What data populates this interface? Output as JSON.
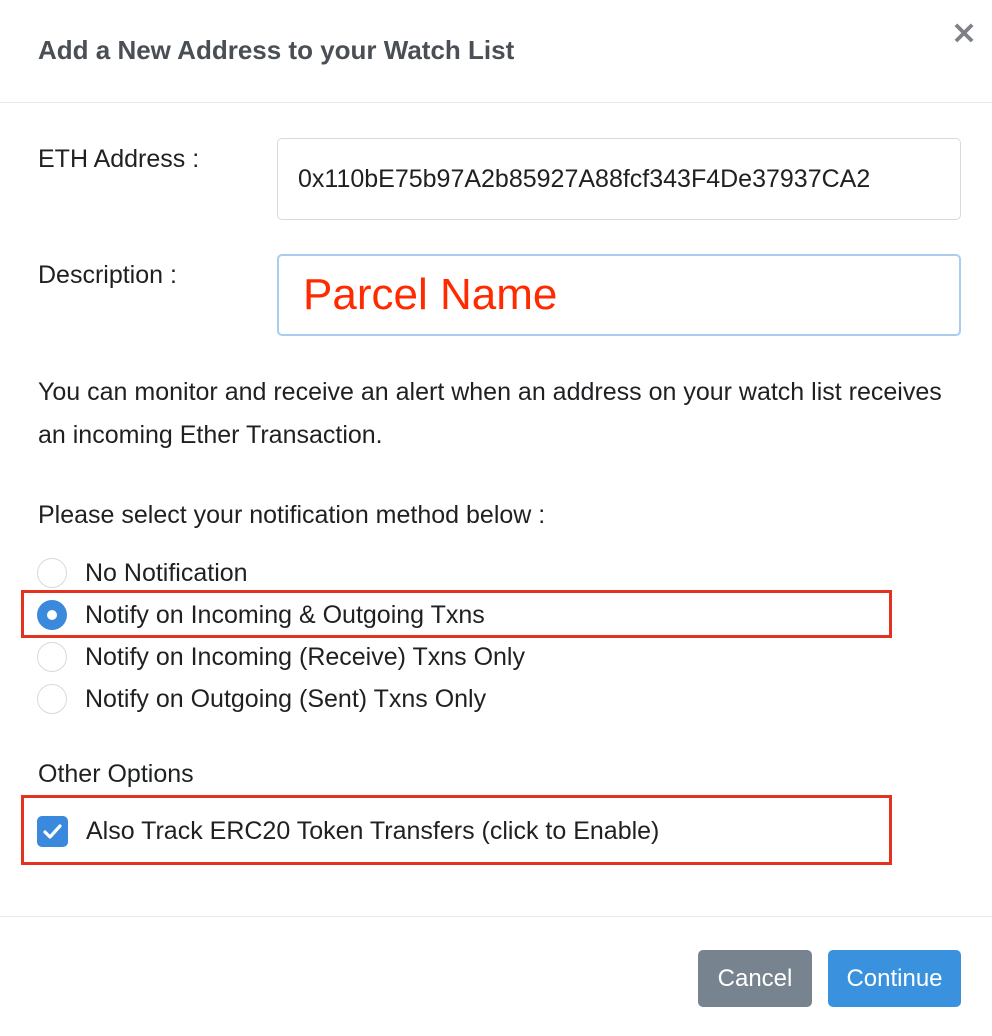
{
  "modal": {
    "title": "Add a New Address to your Watch List",
    "close_symbol": "×"
  },
  "form": {
    "eth_address_label": "ETH Address :",
    "eth_address_value": "0x110bE75b97A2b85927A88fcf343F4De37937CA2",
    "description_label": "Description :",
    "description_value": "Parcel Name"
  },
  "info_text": "You can monitor and receive an alert when an address on your watch list receives an incoming Ether Transaction.",
  "notification": {
    "prompt": "Please select your notification method below :",
    "options": [
      {
        "label": "No Notification",
        "checked": false
      },
      {
        "label": "Notify on Incoming & Outgoing Txns",
        "checked": true
      },
      {
        "label": "Notify on Incoming (Receive) Txns Only",
        "checked": false
      },
      {
        "label": "Notify on Outgoing (Sent) Txns Only",
        "checked": false
      }
    ]
  },
  "other_options": {
    "heading": "Other Options",
    "erc20_label": "Also Track ERC20 Token Transfers (click to Enable)",
    "erc20_checked": true
  },
  "buttons": {
    "cancel": "Cancel",
    "continue": "Continue"
  },
  "colors": {
    "primary": "#3a89dd",
    "secondary": "#77838f",
    "highlight": "#e3321f",
    "description_text": "#ff2a00"
  }
}
